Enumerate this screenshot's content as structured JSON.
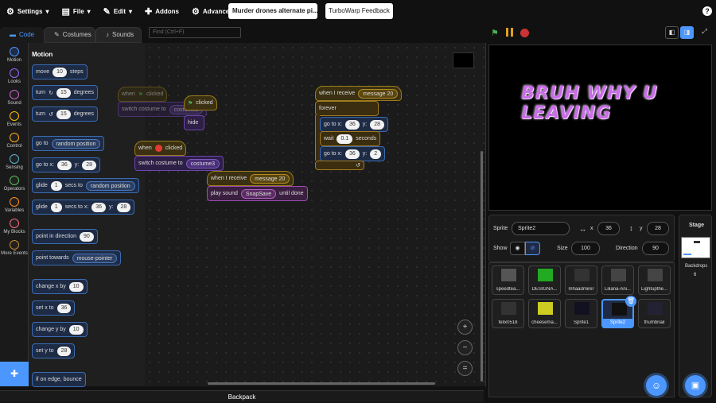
{
  "menu": {
    "settings": "Settings",
    "file": "File",
    "edit": "Edit",
    "addons": "Addons",
    "advanced": "Advanced",
    "project_title": "Murder drones alternate pi...",
    "feedback": "TurboWarp Feedback"
  },
  "tabs": {
    "code": "Code",
    "costumes": "Costumes",
    "sounds": "Sounds"
  },
  "find": {
    "placeholder": "Find (Ctrl+F)"
  },
  "categories": [
    {
      "label": "Motion",
      "color": "#4c97ff"
    },
    {
      "label": "Looks",
      "color": "#9966ff"
    },
    {
      "label": "Sound",
      "color": "#cf63cf"
    },
    {
      "label": "Events",
      "color": "#ffbf00"
    },
    {
      "label": "Control",
      "color": "#ffab19"
    },
    {
      "label": "Sensing",
      "color": "#5cb1d6"
    },
    {
      "label": "Operators",
      "color": "#59c059"
    },
    {
      "label": "Variables",
      "color": "#ff8c1a"
    },
    {
      "label": "My Blocks",
      "color": "#ff6680"
    },
    {
      "label": "More Events",
      "color": "#c48a2a"
    }
  ],
  "palette": {
    "title": "Motion",
    "move": {
      "a": "move",
      "v": "10",
      "b": "steps"
    },
    "turn_right": {
      "a": "turn",
      "v": "15",
      "b": "degrees"
    },
    "turn_left": {
      "a": "turn",
      "v": "15",
      "b": "degrees"
    },
    "goto": {
      "a": "go to",
      "d": "random position"
    },
    "gotoxy": {
      "a": "go to x:",
      "x": "36",
      "b": "y:",
      "y": "28"
    },
    "glide_to": {
      "a": "glide",
      "v": "1",
      "b": "secs to",
      "d": "random position"
    },
    "glide_xy": {
      "a": "glide",
      "v": "1",
      "b": "secs to x:",
      "x": "36",
      "c": "y:",
      "y": "28"
    },
    "point_dir": {
      "a": "point in direction",
      "v": "90"
    },
    "point_towards": {
      "a": "point towards",
      "d": "mouse-pointer"
    },
    "change_x": {
      "a": "change x by",
      "v": "10"
    },
    "set_x": {
      "a": "set x to",
      "v": "36"
    },
    "change_y": {
      "a": "change y by",
      "v": "10"
    },
    "set_y": {
      "a": "set y to",
      "v": "28"
    },
    "bounce": {
      "a": "if on edge, bounce"
    }
  },
  "scripts": {
    "ghost1_hat": "when",
    "ghost1_clicked": "clicked",
    "ghost1_switch": "switch costume to",
    "ghost1_costume": "costume1",
    "ghost1_hide": "hide",
    "ghost2_clicked": "clicked",
    "stop_when": "when",
    "stop_clicked": "clicked",
    "switch2": "switch costume to",
    "costume3": "costume3",
    "recv1": "when I receive",
    "recv1_msg": "message 20",
    "play": "play sound",
    "sound": "SnapSave",
    "until_done": "until done",
    "recv2": "when I receive",
    "recv2_msg": "message 20",
    "forever": "forever",
    "goto1_a": "go to x:",
    "goto1_x": "36",
    "goto1_b": "y:",
    "goto1_y": "28",
    "wait_a": "wait",
    "wait_v": "0.1",
    "wait_b": "seconds",
    "goto2_a": "go to x:",
    "goto2_x": "36",
    "goto2_b": "y:",
    "goto2_y": "2"
  },
  "backpack": "Backpack",
  "stage_text": "BRUH WHY U LEAVING",
  "sprite_info": {
    "sprite_label": "Sprite",
    "sprite_name": "Sprite2",
    "x_label": "x",
    "x": "36",
    "y_label": "y",
    "y": "28",
    "show_label": "Show",
    "size_label": "Size",
    "size": "100",
    "direction_label": "Direction",
    "direction": "90"
  },
  "sprites": [
    {
      "name": "speedtea..."
    },
    {
      "name": "DESIGNA..."
    },
    {
      "name": "mhaadmirer"
    },
    {
      "name": "Liliana-Ani..."
    },
    {
      "name": "Lightupthe..."
    },
    {
      "name": "felix0518"
    },
    {
      "name": "cheesema..."
    },
    {
      "name": "Sprite1"
    },
    {
      "name": "Sprite2"
    },
    {
      "name": "thumbnail"
    }
  ],
  "stage_panel": {
    "title": "Stage",
    "backdrops_label": "Backdrops",
    "backdrops_count": "6"
  },
  "colors": {
    "accent": "#4c97ff",
    "stage_text": "#c86ee6"
  }
}
